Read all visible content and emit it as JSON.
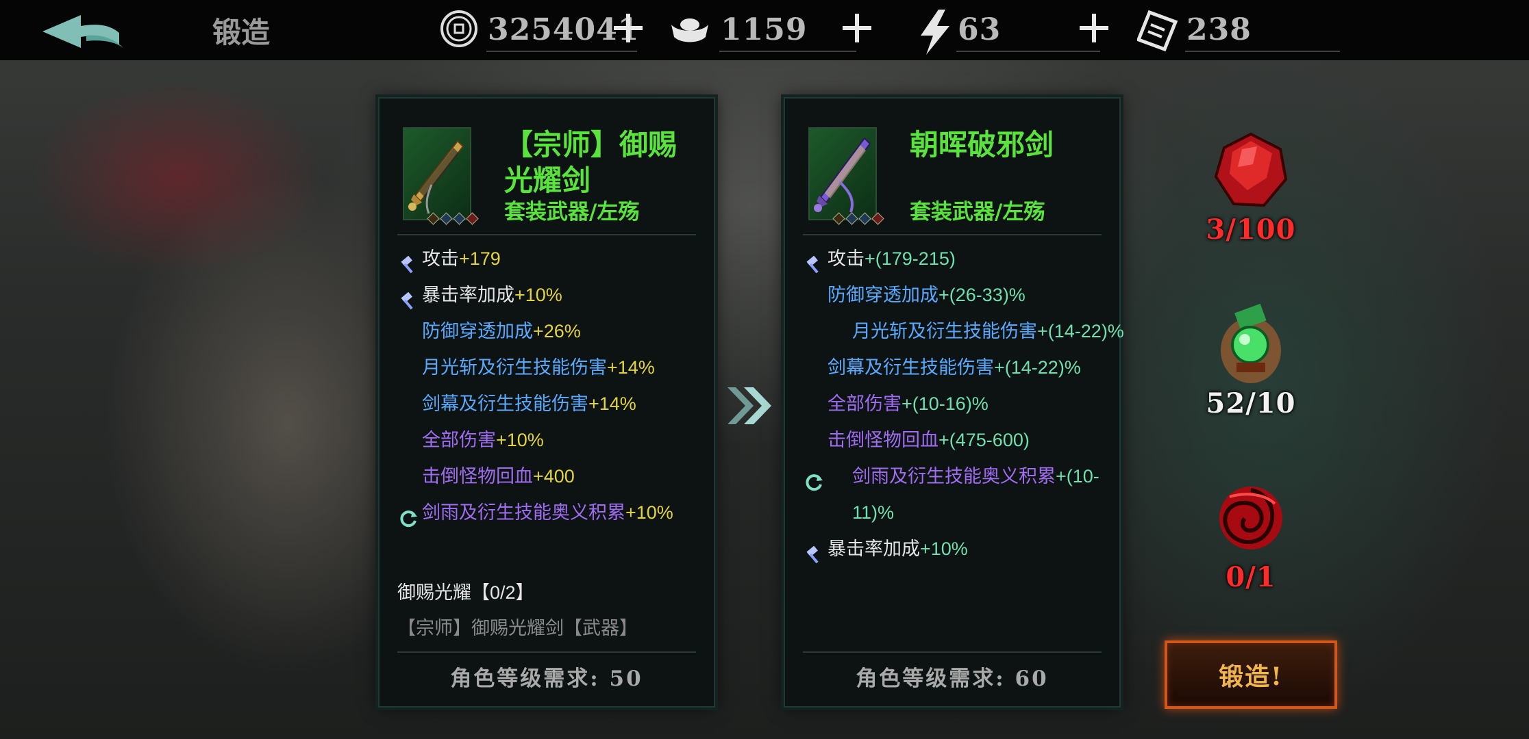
{
  "header": {
    "title": "锻造",
    "currencies": [
      {
        "name": "coin-icon",
        "value": "3254041"
      },
      {
        "name": "silver-ingot-icon",
        "value": "1159"
      },
      {
        "name": "lightning-icon",
        "value": "63"
      },
      {
        "name": "ticket-icon",
        "value": "238"
      }
    ]
  },
  "source_item": {
    "name": "【宗师】御赐光耀剑",
    "type": "套装武器/左殇",
    "stats": [
      {
        "icon": "hammer",
        "label": "攻击",
        "value": "+179",
        "label_color": "white",
        "value_color": "yellow"
      },
      {
        "icon": "hammer",
        "label": "暴击率加成",
        "value": "+10%",
        "label_color": "white",
        "value_color": "yellow"
      },
      {
        "icon": "",
        "label": "防御穿透加成",
        "value": "+26%",
        "label_color": "blue",
        "value_color": "yellow"
      },
      {
        "icon": "",
        "label": "月光斩及衍生技能伤害",
        "value": "+14%",
        "label_color": "blue",
        "value_color": "yellow"
      },
      {
        "icon": "",
        "label": "剑幕及衍生技能伤害",
        "value": "+14%",
        "label_color": "blue",
        "value_color": "yellow"
      },
      {
        "icon": "",
        "label": "全部伤害",
        "value": "+10%",
        "label_color": "purple",
        "value_color": "yellow"
      },
      {
        "icon": "",
        "label": "击倒怪物回血",
        "value": "+400",
        "label_color": "purple",
        "value_color": "yellow"
      },
      {
        "icon": "refresh",
        "label": "剑雨及衍生技能奥义积累",
        "value": "+10%",
        "label_color": "purple",
        "value_color": "yellow"
      }
    ],
    "set_title": "御赐光耀【0/2】",
    "set_piece": "【宗师】御赐光耀剑【武器】",
    "requirement": "角色等级需求: 50"
  },
  "target_item": {
    "name": "朝晖破邪剑",
    "type": "套装武器/左殇",
    "stats": [
      {
        "icon": "hammer",
        "label": "攻击",
        "value": "+(179-215)",
        "label_color": "white",
        "value_color": "green"
      },
      {
        "icon": "",
        "label": "防御穿透加成",
        "value": "+(26-33)%",
        "label_color": "blue",
        "value_color": "green"
      },
      {
        "icon": "",
        "label": "月光斩及衍生技能伤害",
        "value": "+(14-22)%",
        "label_color": "blue",
        "value_color": "green",
        "wrap": true
      },
      {
        "icon": "",
        "label": "剑幕及衍生技能伤害",
        "value": "+(14-22)%",
        "label_color": "blue",
        "value_color": "green"
      },
      {
        "icon": "",
        "label": "全部伤害",
        "value": "+(10-16)%",
        "label_color": "purple",
        "value_color": "green"
      },
      {
        "icon": "",
        "label": "击倒怪物回血",
        "value": "+(475-600)",
        "label_color": "purple",
        "value_color": "green"
      },
      {
        "icon": "refresh",
        "label": "剑雨及衍生技能奥义积累",
        "value": "+(10-11)%",
        "label_color": "purple",
        "value_color": "green",
        "wrap": true
      },
      {
        "icon": "hammer",
        "label": "暴击率加成",
        "value": "+10%",
        "label_color": "white",
        "value_color": "green"
      }
    ],
    "requirement": "角色等级需求: 60"
  },
  "materials": [
    {
      "name": "red-crystal-icon",
      "count": "3/100",
      "color": "#ff2a2a"
    },
    {
      "name": "green-orb-icon",
      "count": "52/10",
      "color": "#f2f2f2"
    },
    {
      "name": "red-rose-icon",
      "count": "0/1",
      "color": "#ff2a2a"
    }
  ],
  "forge_label": "锻造!"
}
